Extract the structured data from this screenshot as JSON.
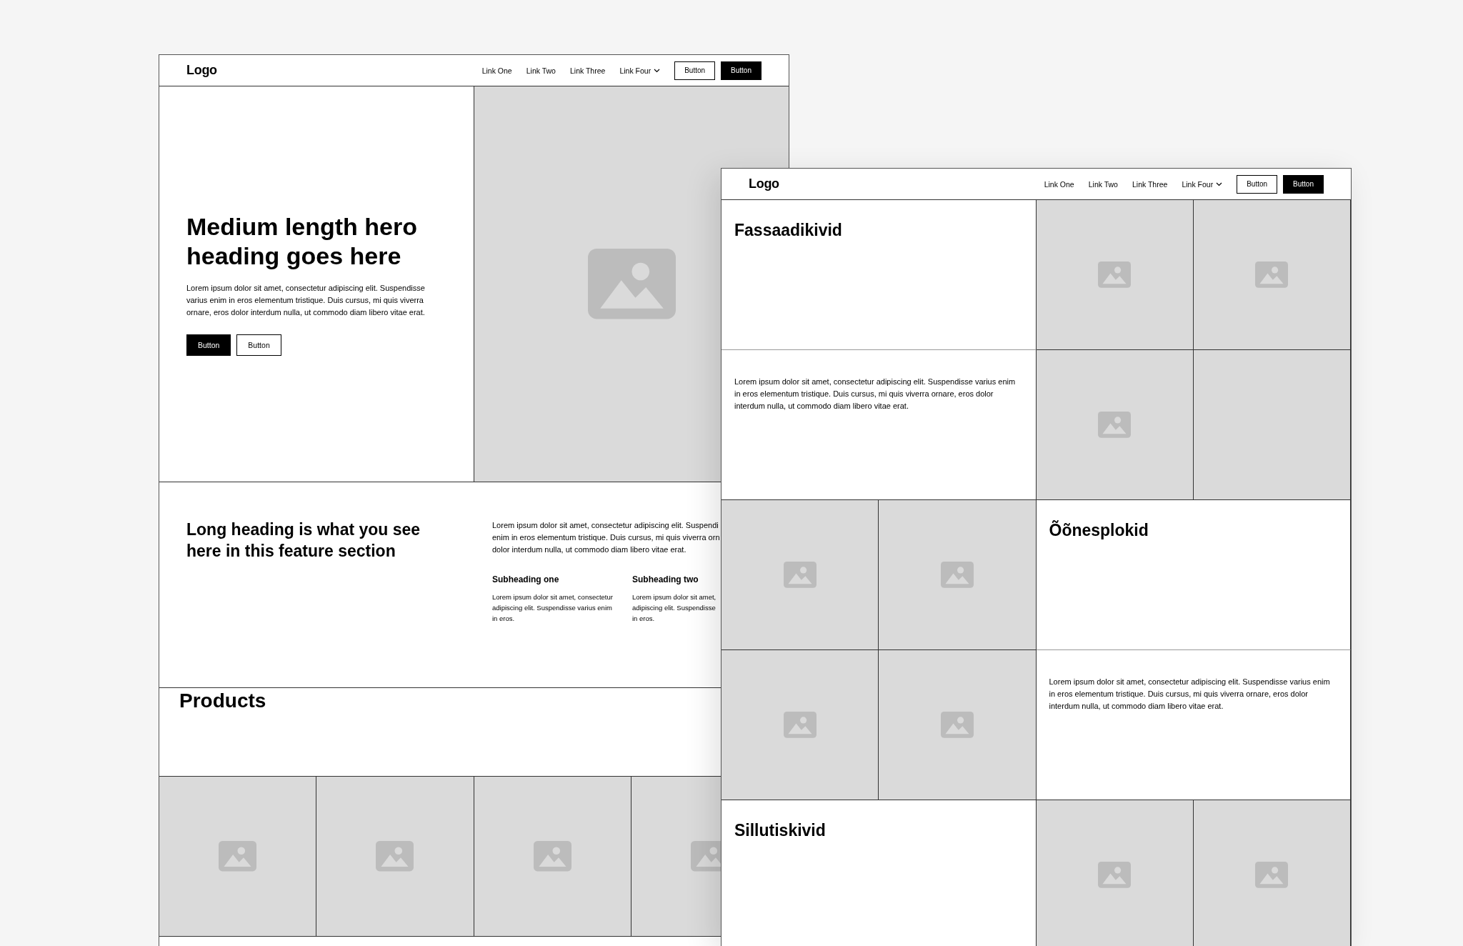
{
  "pages": [
    {
      "nav": {
        "logo": "Logo",
        "links": [
          {
            "label": "Link One",
            "dropdown": false
          },
          {
            "label": "Link Two",
            "dropdown": false
          },
          {
            "label": "Link Three",
            "dropdown": false
          },
          {
            "label": "Link Four",
            "dropdown": true
          }
        ],
        "buttons": [
          {
            "label": "Button",
            "kind": "outline"
          },
          {
            "label": "Button",
            "kind": "solid"
          }
        ]
      },
      "hero": {
        "heading": "Medium length hero heading goes here",
        "body": "Lorem ipsum dolor sit amet, consectetur adipiscing elit. Suspendisse varius enim in eros elementum tristique. Duis cursus, mi quis viverra ornare, eros dolor interdum nulla, ut commodo diam libero vitae erat.",
        "buttons": [
          {
            "label": "Button",
            "kind": "solid"
          },
          {
            "label": "Button",
            "kind": "outline"
          }
        ],
        "image": {
          "kind": "picture"
        }
      },
      "feature": {
        "heading": "Long heading is what you see here in this feature section",
        "body_lines": [
          "Lorem ipsum dolor sit amet, consectetur adipiscing elit. Suspendi",
          "enim in eros elementum tristique. Duis cursus, mi quis viverra orn",
          "dolor interdum nulla, ut commodo diam libero vitae erat."
        ],
        "columns": [
          {
            "subheading": "Subheading one",
            "body_lines": [
              "Lorem ipsum dolor sit amet, consectetur",
              "adipiscing elit. Suspendisse varius enim",
              "in eros."
            ]
          },
          {
            "subheading": "Subheading two",
            "body_lines": [
              "Lorem ipsum dolor sit amet,",
              "adipiscing elit. Suspendisse",
              "in eros."
            ]
          }
        ]
      },
      "products": {
        "heading": "Products",
        "items": [
          {
            "kind": "picture"
          },
          {
            "kind": "picture"
          },
          {
            "kind": "picture"
          },
          {
            "kind": "picture"
          }
        ]
      }
    },
    {
      "nav": {
        "logo": "Logo",
        "links": [
          {
            "label": "Link One",
            "dropdown": false
          },
          {
            "label": "Link Two",
            "dropdown": false
          },
          {
            "label": "Link Three",
            "dropdown": false
          },
          {
            "label": "Link Four",
            "dropdown": true
          }
        ],
        "buttons": [
          {
            "label": "Button",
            "kind": "outline"
          },
          {
            "label": "Button",
            "kind": "solid"
          }
        ]
      },
      "cells": [
        {
          "kind": "heading",
          "text": "Fassaadikivid"
        },
        {
          "kind": "picture"
        },
        {
          "kind": "picture"
        },
        {
          "kind": "text",
          "text": "Lorem ipsum dolor sit amet, consectetur adipiscing elit. Suspendisse varius enim in eros elementum tristique. Duis cursus, mi quis viverra ornare, eros dolor interdum nulla, ut commodo diam libero vitae erat."
        },
        {
          "kind": "picture"
        },
        {
          "kind": "blank"
        },
        {
          "kind": "picture"
        },
        {
          "kind": "picture"
        },
        {
          "kind": "heading",
          "text": "Õõnesplokid"
        },
        {
          "kind": "picture"
        },
        {
          "kind": "picture"
        },
        {
          "kind": "text",
          "text": "Lorem ipsum dolor sit amet, consectetur adipiscing elit. Suspendisse varius enim in eros elementum tristique. Duis cursus, mi quis viverra ornare, eros dolor interdum nulla, ut commodo diam libero vitae erat."
        },
        {
          "kind": "heading",
          "text": "Sillutiskivid"
        },
        {
          "kind": "picture"
        },
        {
          "kind": "picture"
        }
      ]
    }
  ]
}
